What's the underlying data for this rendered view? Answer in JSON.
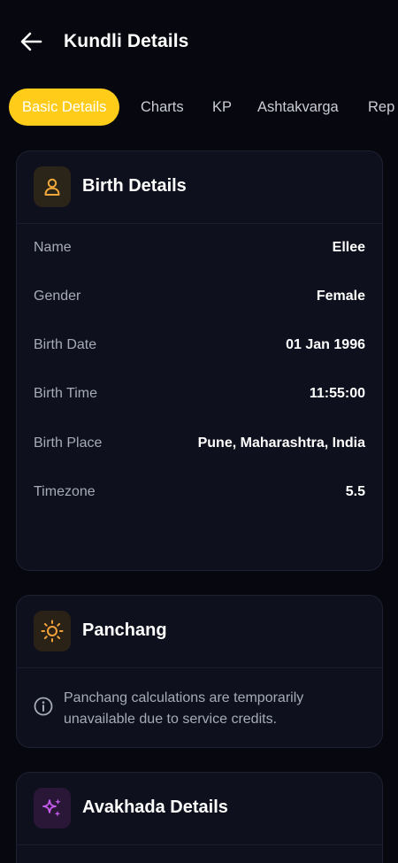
{
  "header": {
    "title": "Kundli Details",
    "back_icon": "arrow-left-icon"
  },
  "tabs": [
    {
      "label": "Basic Details",
      "active": true
    },
    {
      "label": "Charts",
      "active": false
    },
    {
      "label": "KP",
      "active": false
    },
    {
      "label": "Ashtakvarga",
      "active": false
    },
    {
      "label": "Rep",
      "active": false
    }
  ],
  "birth_details": {
    "title": "Birth Details",
    "icon": "user-icon",
    "rows": [
      {
        "label": "Name",
        "value": "Ellee"
      },
      {
        "label": "Gender",
        "value": "Female"
      },
      {
        "label": "Birth Date",
        "value": "01 Jan 1996"
      },
      {
        "label": "Birth Time",
        "value": "11:55:00"
      },
      {
        "label": "Birth Place",
        "value": "Pune, Maharashtra, India"
      },
      {
        "label": "Timezone",
        "value": "5.5"
      }
    ]
  },
  "panchang": {
    "title": "Panchang",
    "icon": "sun-icon",
    "notice_icon": "info-icon",
    "notice": "Panchang calculations are temporarily unavailable due to service credits."
  },
  "avakhada": {
    "title": "Avakhada Details",
    "icon": "sparkles-icon"
  },
  "colors": {
    "background": "#07080f",
    "card": "#0e101d",
    "accent_yellow": "#ffcc1a",
    "icon_user": "#f0a93a",
    "icon_sun": "#f4a23a",
    "icon_sparkle": "#c85cf0"
  }
}
